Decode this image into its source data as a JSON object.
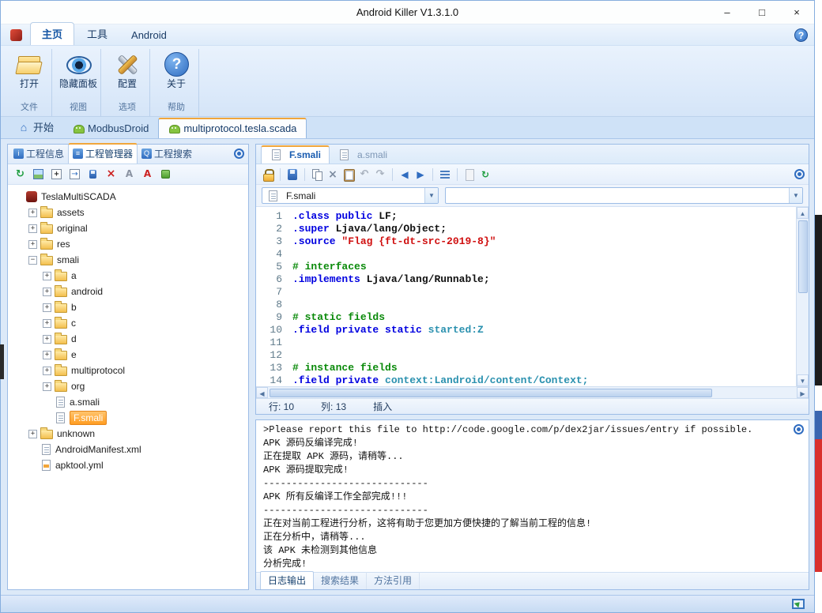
{
  "titlebar": {
    "title": "Android Killer V1.3.1.0",
    "minimize": "–",
    "maximize": "□",
    "close": "×"
  },
  "ribbon": {
    "tabs": [
      {
        "label": "主页",
        "active": true
      },
      {
        "label": "工具",
        "active": false
      },
      {
        "label": "Android",
        "active": false
      }
    ],
    "help_icon": "?",
    "groups": [
      {
        "button": "打开",
        "caption": "文件",
        "icon": "open-folder-icon"
      },
      {
        "button": "隐藏面板",
        "caption": "视图",
        "icon": "eye-big-icon"
      },
      {
        "button": "配置",
        "caption": "选项",
        "icon": "config-icon"
      },
      {
        "button": "关于",
        "caption": "帮助",
        "icon": "about-icon"
      }
    ]
  },
  "doc_tabs": [
    {
      "label": "开始",
      "icon": "home-icon",
      "active": false
    },
    {
      "label": "ModbusDroid",
      "icon": "android-icon",
      "active": false
    },
    {
      "label": "multiprotocol.tesla.scada",
      "icon": "android-icon",
      "active": true
    }
  ],
  "left_panel": {
    "tabs": [
      {
        "label": "工程信息",
        "icon_glyph": "i",
        "active": false
      },
      {
        "label": "工程管理器",
        "icon_glyph": "≡",
        "active": true
      },
      {
        "label": "工程搜索",
        "icon_glyph": "Q",
        "active": false
      }
    ],
    "toolbar_icons": [
      "refresh-icon",
      "view-icon",
      "expand-icon",
      "locate-icon",
      "save-all-icon",
      "delete-icon",
      "clear-icon",
      "font-icon",
      "install-icon"
    ],
    "tree": [
      {
        "label": "TeslaMultiSCADA",
        "level": 0,
        "kind": "root",
        "exp": ""
      },
      {
        "label": "assets",
        "level": 1,
        "kind": "folder",
        "exp": "+"
      },
      {
        "label": "original",
        "level": 1,
        "kind": "folder",
        "exp": "+"
      },
      {
        "label": "res",
        "level": 1,
        "kind": "folder",
        "exp": "+"
      },
      {
        "label": "smali",
        "level": 1,
        "kind": "folder",
        "exp": "-"
      },
      {
        "label": "a",
        "level": 2,
        "kind": "folder",
        "exp": "+"
      },
      {
        "label": "android",
        "level": 2,
        "kind": "folder",
        "exp": "+"
      },
      {
        "label": "b",
        "level": 2,
        "kind": "folder",
        "exp": "+"
      },
      {
        "label": "c",
        "level": 2,
        "kind": "folder",
        "exp": "+"
      },
      {
        "label": "d",
        "level": 2,
        "kind": "folder",
        "exp": "+"
      },
      {
        "label": "e",
        "level": 2,
        "kind": "folder",
        "exp": "+"
      },
      {
        "label": "multiprotocol",
        "level": 2,
        "kind": "folder",
        "exp": "+"
      },
      {
        "label": "org",
        "level": 2,
        "kind": "folder",
        "exp": "+"
      },
      {
        "label": "a.smali",
        "level": 2,
        "kind": "file",
        "exp": ""
      },
      {
        "label": "F.smali",
        "level": 2,
        "kind": "file",
        "exp": "",
        "selected": true
      },
      {
        "label": "unknown",
        "level": 1,
        "kind": "folder",
        "exp": "+"
      },
      {
        "label": "AndroidManifest.xml",
        "level": 1,
        "kind": "file",
        "exp": ""
      },
      {
        "label": "apktool.yml",
        "level": 1,
        "kind": "file-alt",
        "exp": ""
      }
    ]
  },
  "editor": {
    "tabs": [
      {
        "label": "F.smali",
        "active": true
      },
      {
        "label": "a.smali",
        "active": false
      }
    ],
    "toolbar_icons": [
      "lock-icon",
      "sep",
      "save-icon",
      "sep",
      "copy-icon",
      "cut-icon",
      "paste-icon",
      "undo-icon",
      "redo-icon",
      "sep",
      "back-icon",
      "forward-icon",
      "sep",
      "format-icon",
      "sep",
      "doc2-icon",
      "encode-icon"
    ],
    "file_dropdown": "F.smali",
    "method_dropdown": "",
    "code": [
      {
        "n": 1,
        "tokens": [
          {
            "t": ".class public ",
            "c": "kw"
          },
          {
            "t": "LF;",
            "c": "pl"
          }
        ]
      },
      {
        "n": 2,
        "tokens": [
          {
            "t": ".super ",
            "c": "kw"
          },
          {
            "t": "Ljava/lang/Object;",
            "c": "pl"
          }
        ]
      },
      {
        "n": 3,
        "tokens": [
          {
            "t": ".source ",
            "c": "kw"
          },
          {
            "t": "\"Flag {ft-dt-src-2019-8}\"",
            "c": "str"
          }
        ]
      },
      {
        "n": 4,
        "tokens": []
      },
      {
        "n": 5,
        "tokens": [
          {
            "t": "# interfaces",
            "c": "com"
          }
        ]
      },
      {
        "n": 6,
        "tokens": [
          {
            "t": ".implements ",
            "c": "kw"
          },
          {
            "t": "Ljava/lang/Runnable;",
            "c": "pl"
          }
        ]
      },
      {
        "n": 7,
        "tokens": []
      },
      {
        "n": 8,
        "tokens": []
      },
      {
        "n": 9,
        "tokens": [
          {
            "t": "# static fields",
            "c": "com"
          }
        ]
      },
      {
        "n": 10,
        "tokens": [
          {
            "t": ".field private static ",
            "c": "kw"
          },
          {
            "t": "started:Z",
            "c": "typ"
          }
        ]
      },
      {
        "n": 11,
        "tokens": []
      },
      {
        "n": 12,
        "tokens": []
      },
      {
        "n": 13,
        "tokens": [
          {
            "t": "# instance fields",
            "c": "com"
          }
        ]
      },
      {
        "n": 14,
        "tokens": [
          {
            "t": ".field private ",
            "c": "kw"
          },
          {
            "t": "context:Landroid/content/Context;",
            "c": "typ"
          }
        ]
      }
    ],
    "status": {
      "line_label": "行: 10",
      "col_label": "列: 13",
      "mode_label": "插入"
    }
  },
  "log_panel": {
    "lines": [
      ">Please report this file to http://code.google.com/p/dex2jar/issues/entry if possible.",
      "APK 源码反编译完成!",
      "正在提取 APK 源码，请稍等...",
      "APK 源码提取完成!",
      "-----------------------------",
      "APK 所有反编译工作全部完成!!!",
      "-----------------------------",
      "正在对当前工程进行分析，这将有助于您更加方便快捷的了解当前工程的信息!",
      "正在分析中，请稍等...",
      "该 APK 未检测到其他信息",
      "分析完成!"
    ],
    "tabs": [
      {
        "label": "日志输出",
        "active": true
      },
      {
        "label": "搜索结果",
        "active": false
      },
      {
        "label": "方法引用",
        "active": false
      }
    ]
  }
}
